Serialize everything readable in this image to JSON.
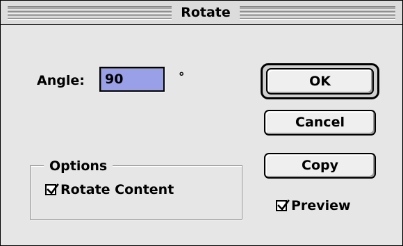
{
  "window": {
    "title": "Rotate"
  },
  "angle": {
    "label": "Angle:",
    "value": "90",
    "unit": "°"
  },
  "buttons": {
    "ok": "OK",
    "cancel": "Cancel",
    "copy": "Copy"
  },
  "options": {
    "title": "Options",
    "rotate_content": {
      "label": "Rotate Content",
      "checked": true
    }
  },
  "preview": {
    "label": "Preview",
    "checked": true
  },
  "colors": {
    "selection": "#9aa0e8",
    "dialog_background": "#e6e6e6"
  }
}
